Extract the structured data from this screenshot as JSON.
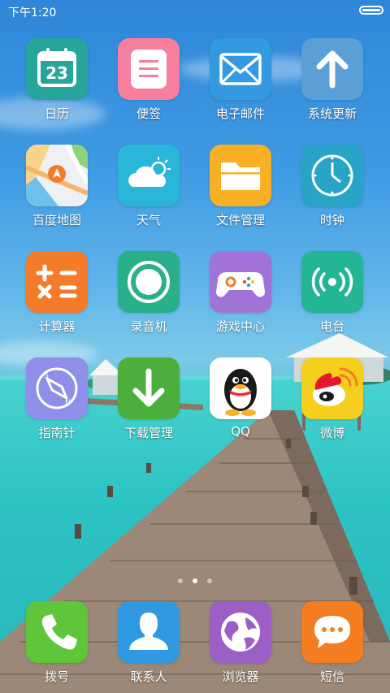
{
  "status_bar": {
    "time": "下午1:20",
    "battery_icon": "battery-icon"
  },
  "colors": {
    "calendar": "#26a69a",
    "notes": "#f57f9d",
    "email": "#3399e0",
    "update": "#5a9fd6",
    "maps": "#eef1f2",
    "weather": "#29b6d8",
    "files": "#f9b024",
    "clock": "#27a4c6",
    "calculator": "#f47b29",
    "recorder": "#29b08a",
    "games": "#a173d6",
    "radio": "#23b594",
    "compass": "#8f8ee8",
    "download": "#4caf3b",
    "qq": "#ffffff",
    "weibo": "#f5cf1e",
    "phone": "#5fc53a",
    "contacts": "#2f9ae2",
    "browser": "#9c5fc6",
    "sms": "#f57d21"
  },
  "apps": [
    {
      "label": "日历",
      "icon": "calendar-icon",
      "date": "23"
    },
    {
      "label": "便签",
      "icon": "notes-icon"
    },
    {
      "label": "电子邮件",
      "icon": "email-icon"
    },
    {
      "label": "系统更新",
      "icon": "update-arrow-icon"
    },
    {
      "label": "百度地图",
      "icon": "map-icon"
    },
    {
      "label": "天气",
      "icon": "weather-icon"
    },
    {
      "label": "文件管理",
      "icon": "folder-icon"
    },
    {
      "label": "时钟",
      "icon": "clock-icon"
    },
    {
      "label": "计算器",
      "icon": "calculator-icon"
    },
    {
      "label": "录音机",
      "icon": "recorder-icon"
    },
    {
      "label": "游戏中心",
      "icon": "gamepad-icon"
    },
    {
      "label": "电台",
      "icon": "radio-icon"
    },
    {
      "label": "指南针",
      "icon": "compass-icon"
    },
    {
      "label": "下载管理",
      "icon": "download-icon"
    },
    {
      "label": "QQ",
      "icon": "qq-penguin-icon"
    },
    {
      "label": "微博",
      "icon": "weibo-icon"
    }
  ],
  "page_indicator": {
    "pages": 3,
    "current": 2
  },
  "dock": [
    {
      "label": "拨号",
      "icon": "phone-icon"
    },
    {
      "label": "联系人",
      "icon": "contacts-icon"
    },
    {
      "label": "浏览器",
      "icon": "browser-icon"
    },
    {
      "label": "短信",
      "icon": "message-icon"
    }
  ]
}
